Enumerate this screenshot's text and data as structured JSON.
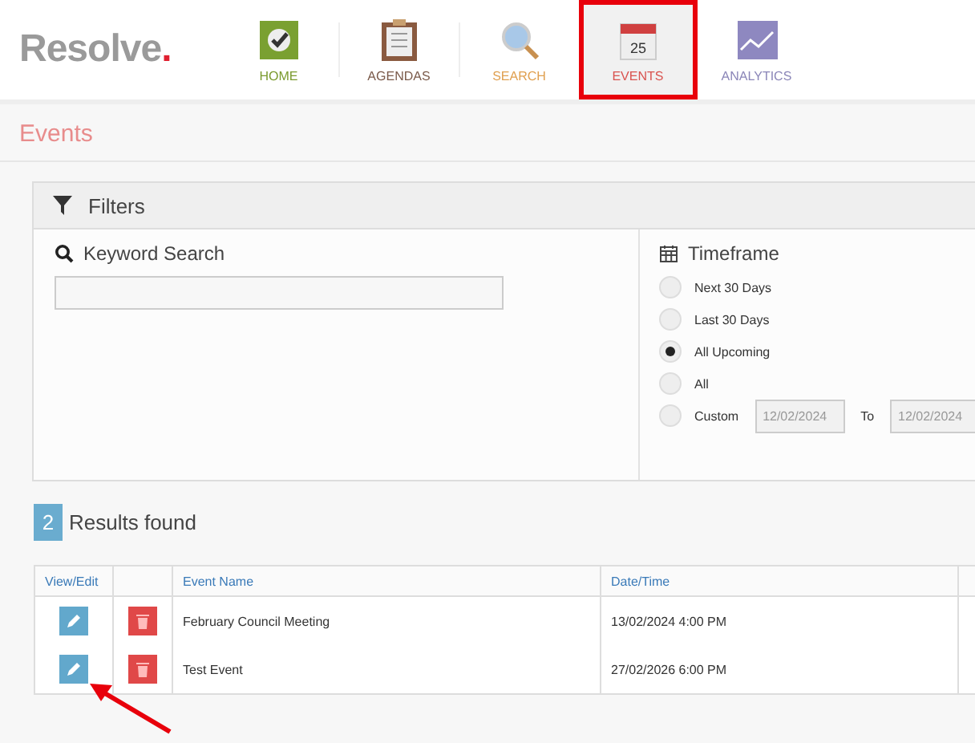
{
  "brand": {
    "name": "Resolve",
    "dot": "."
  },
  "nav": [
    {
      "label": "HOME",
      "kind": "home",
      "color": "#7a9a2e",
      "selected": false,
      "highlighted": false
    },
    {
      "label": "AGENDAS",
      "kind": "agendas",
      "color": "#7a5a4a",
      "selected": false,
      "highlighted": false
    },
    {
      "label": "SEARCH",
      "kind": "search",
      "color": "#e0a050",
      "selected": false,
      "highlighted": false
    },
    {
      "label": "EVENTS",
      "kind": "events",
      "icon_text": "25",
      "color": "#d9534f",
      "selected": true,
      "highlighted": true
    },
    {
      "label": "ANALYTICS",
      "kind": "analytics",
      "color": "#8b86b8",
      "selected": false,
      "highlighted": false
    }
  ],
  "page_title": "Events",
  "filters": {
    "title": "Filters",
    "keyword": {
      "label": "Keyword Search"
    },
    "timeframe": {
      "label": "Timeframe",
      "options": [
        {
          "label": "Next 30 Days",
          "selected": false
        },
        {
          "label": "Last 30 Days",
          "selected": false
        },
        {
          "label": "All Upcoming",
          "selected": true
        },
        {
          "label": "All",
          "selected": false
        },
        {
          "label": "Custom",
          "selected": false
        }
      ],
      "from": "12/02/2024",
      "to_label": "To",
      "to": "12/02/2024"
    }
  },
  "results": {
    "count": "2",
    "label": "Results found"
  },
  "table": {
    "columns": [
      "View/Edit",
      "",
      "Event Name",
      "Date/Time"
    ],
    "rows": [
      {
        "name": "February Council Meeting",
        "datetime": "13/02/2024 4:00 PM",
        "pointed": false
      },
      {
        "name": "Test Event",
        "datetime": "27/02/2026 6:00 PM",
        "pointed": true
      }
    ]
  }
}
